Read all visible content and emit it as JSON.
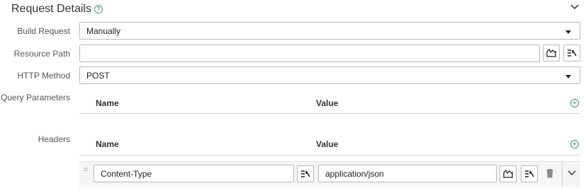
{
  "section": {
    "title": "Request Details",
    "help_glyph": "?"
  },
  "form": {
    "build_request": {
      "label": "Build Request",
      "value": "Manually"
    },
    "resource_path": {
      "label": "Resource Path",
      "value": ""
    },
    "http_method": {
      "label": "HTTP Method",
      "value": "POST"
    },
    "query_parameters": {
      "label": "Query Parameters",
      "columns": [
        "Name",
        "Value"
      ]
    },
    "headers": {
      "label": "Headers",
      "columns": [
        "Name",
        "Value"
      ],
      "rows": [
        {
          "name": "Content-Type",
          "value": "application/json"
        }
      ]
    }
  },
  "icons": {
    "add": "plus-circle-icon",
    "collapse": "chevron-down-icon",
    "variable": "variable-picker-icon",
    "chart": "chart-icon",
    "delete": "trash-icon",
    "drag": "drag-handle-icon"
  },
  "colors": {
    "accent": "#3d8f6e",
    "border": "#b9b9b9",
    "divider": "#d7d7d7"
  }
}
